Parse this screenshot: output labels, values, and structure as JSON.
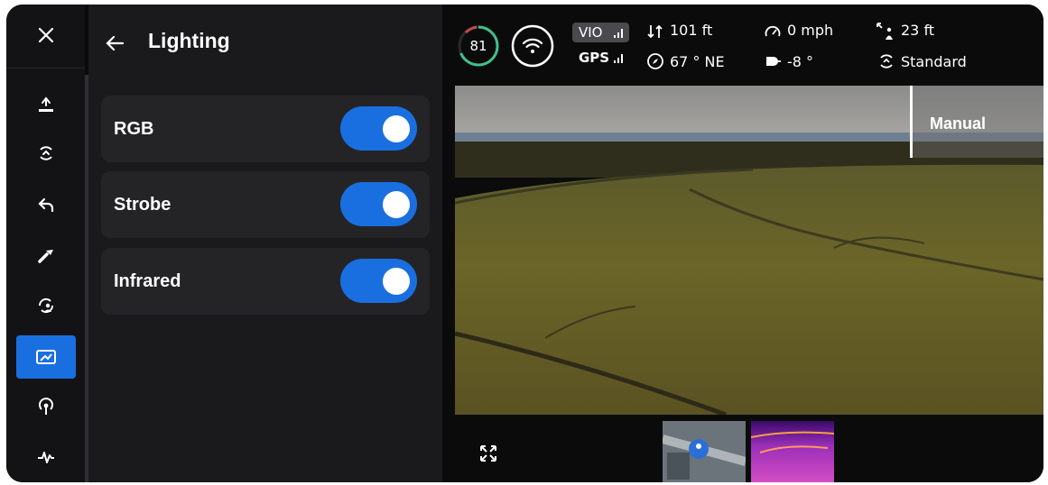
{
  "panel": {
    "title": "Lighting"
  },
  "lights": [
    {
      "label": "RGB",
      "on": true
    },
    {
      "label": "Strobe",
      "on": true
    },
    {
      "label": "Infrared",
      "on": true
    }
  ],
  "status": {
    "battery": "81",
    "vio_label": "VIO",
    "gps_label": "GPS",
    "altitude": "101 ft",
    "heading": "67 ° NE",
    "speed": "0 mph",
    "gimbal": "-8 °",
    "distance": "23 ft",
    "mode": "Standard"
  },
  "camera": {
    "mode_label": "Manual"
  },
  "rail": {
    "items": [
      "takeoff-icon",
      "return-icon",
      "back-arrow-icon",
      "flashlight-icon",
      "rotate-user-icon",
      "image-icon",
      "signal-icon",
      "pulse-icon"
    ],
    "active_index": 5
  },
  "colors": {
    "accent": "#1a6fe0",
    "battery_ring": "#3fc28a"
  }
}
